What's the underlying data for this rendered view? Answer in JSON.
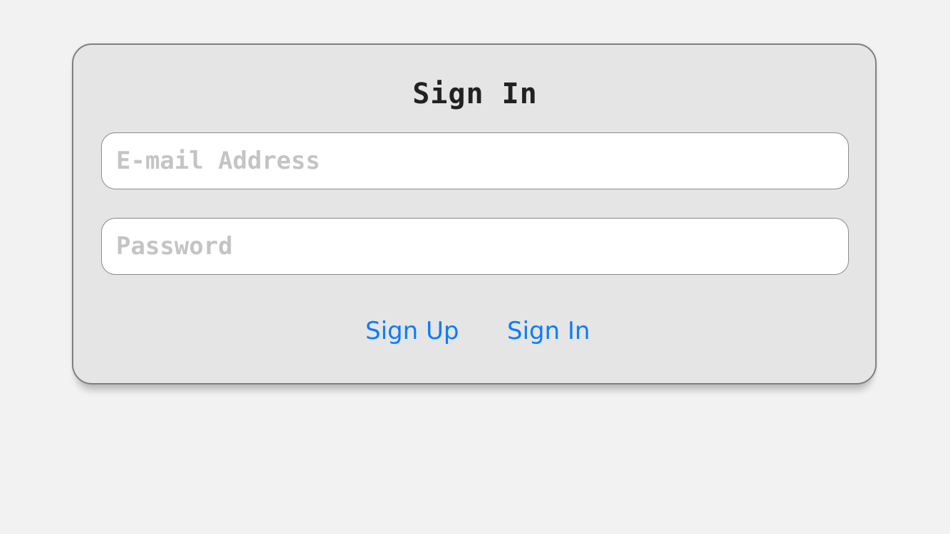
{
  "form": {
    "title": "Sign In",
    "email": {
      "value": "",
      "placeholder": "E-mail Address"
    },
    "password": {
      "value": "",
      "placeholder": "Password"
    },
    "sign_up_label": "Sign Up",
    "sign_in_label": "Sign In"
  },
  "colors": {
    "background": "#f2f2f2",
    "card": "#e5e5e5",
    "link": "#0a7cff",
    "placeholder": "#c4c4c4"
  }
}
